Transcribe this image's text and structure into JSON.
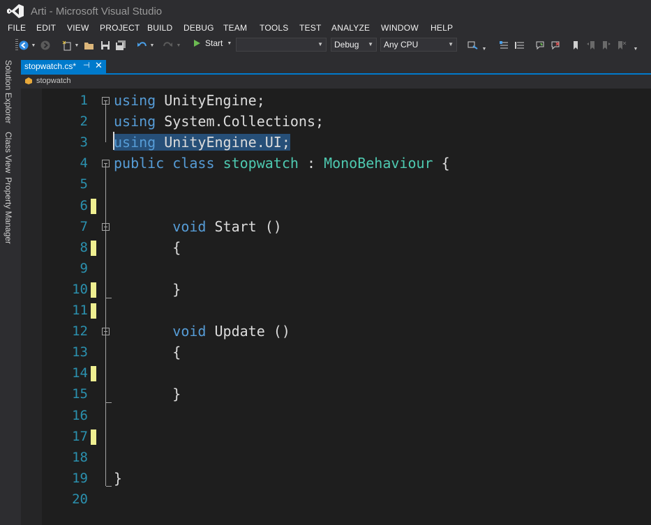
{
  "window": {
    "title": "Arti - Microsoft Visual Studio"
  },
  "menu": [
    "FILE",
    "EDIT",
    "VIEW",
    "PROJECT",
    "BUILD",
    "DEBUG",
    "TEAM",
    "TOOLS",
    "TEST",
    "ANALYZE",
    "WINDOW",
    "HELP"
  ],
  "toolbar": {
    "start_label": "Start",
    "config": "Debug",
    "platform": "Any CPU",
    "target": ""
  },
  "sidebar": {
    "tabs": [
      "Solution Explorer",
      "Class View",
      "Property Manager"
    ]
  },
  "tab": {
    "label": "stopwatch.cs*",
    "pin_glyph": "⊣",
    "close_glyph": "✕"
  },
  "navigation": {
    "class_name": "stopwatch"
  },
  "editor": {
    "line_numbers": [
      "1",
      "2",
      "3",
      "4",
      "5",
      "6",
      "7",
      "8",
      "9",
      "10",
      "11",
      "12",
      "13",
      "14",
      "15",
      "16",
      "17",
      "18",
      "19",
      "20"
    ],
    "changed_lines": [
      6,
      8,
      10,
      11,
      14,
      17
    ],
    "collapsible_lines": [
      1,
      4,
      7,
      12
    ],
    "lines": [
      [
        [
          "kw",
          "using"
        ],
        [
          "pl",
          " UnityEngine;"
        ]
      ],
      [
        [
          "kw",
          "using"
        ],
        [
          "pl",
          " System.Collections;"
        ]
      ],
      [
        [
          "kw",
          "using"
        ],
        [
          "pl",
          " UnityEngine.UI;"
        ]
      ],
      [
        [
          "kw",
          "public"
        ],
        [
          "pl",
          " "
        ],
        [
          "kw",
          "class"
        ],
        [
          "pl",
          " "
        ],
        [
          "ty",
          "stopwatch"
        ],
        [
          "pl",
          " : "
        ],
        [
          "ty",
          "MonoBehaviour"
        ],
        [
          "pl",
          " {"
        ]
      ],
      [],
      [],
      [
        [
          "pl",
          "       "
        ],
        [
          "kw",
          "void"
        ],
        [
          "pl",
          " Start ()"
        ]
      ],
      [
        [
          "pl",
          "       {"
        ]
      ],
      [],
      [
        [
          "pl",
          "       }"
        ]
      ],
      [],
      [
        [
          "pl",
          "       "
        ],
        [
          "kw",
          "void"
        ],
        [
          "pl",
          " Update ()"
        ]
      ],
      [
        [
          "pl",
          "       {"
        ]
      ],
      [],
      [
        [
          "pl",
          "       }"
        ]
      ],
      [],
      [],
      [],
      [
        [
          "pl",
          "}"
        ]
      ],
      []
    ],
    "selected_line": 3
  },
  "colors": {
    "accent": "#007acc",
    "keyword": "#569cd6",
    "type": "#4ec9b0",
    "linenum": "#2b91af",
    "change": "#efef91"
  }
}
